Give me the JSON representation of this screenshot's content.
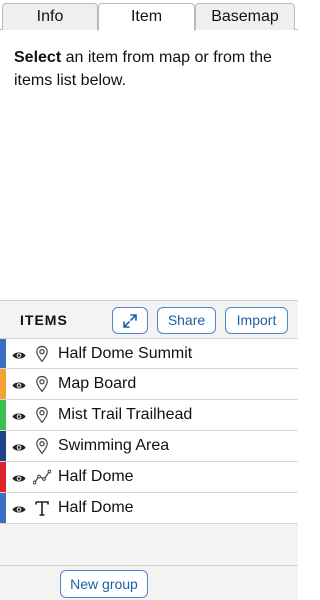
{
  "tabs": {
    "info": "Info",
    "item": "Item",
    "basemap": "Basemap"
  },
  "panel": {
    "select_bold": "Select",
    "select_rest": " an item from map or from the items list below."
  },
  "items": {
    "title": "ITEMS",
    "share_label": "Share",
    "import_label": "Import",
    "new_group_label": "New group",
    "list": [
      {
        "label": "Half Dome Summit",
        "color": "#3b6fc4",
        "icon": "map-pin-icon"
      },
      {
        "label": "Map Board",
        "color": "#f2a232",
        "icon": "map-pin-icon"
      },
      {
        "label": "Mist Trail Trailhead",
        "color": "#3cc04c",
        "icon": "map-pin-icon"
      },
      {
        "label": "Swimming Area",
        "color": "#21438a",
        "icon": "map-pin-icon"
      },
      {
        "label": "Half Dome",
        "color": "#e0232b",
        "icon": "line-icon"
      },
      {
        "label": "Half Dome",
        "color": "#3b6fc4",
        "icon": "text-icon"
      }
    ]
  }
}
